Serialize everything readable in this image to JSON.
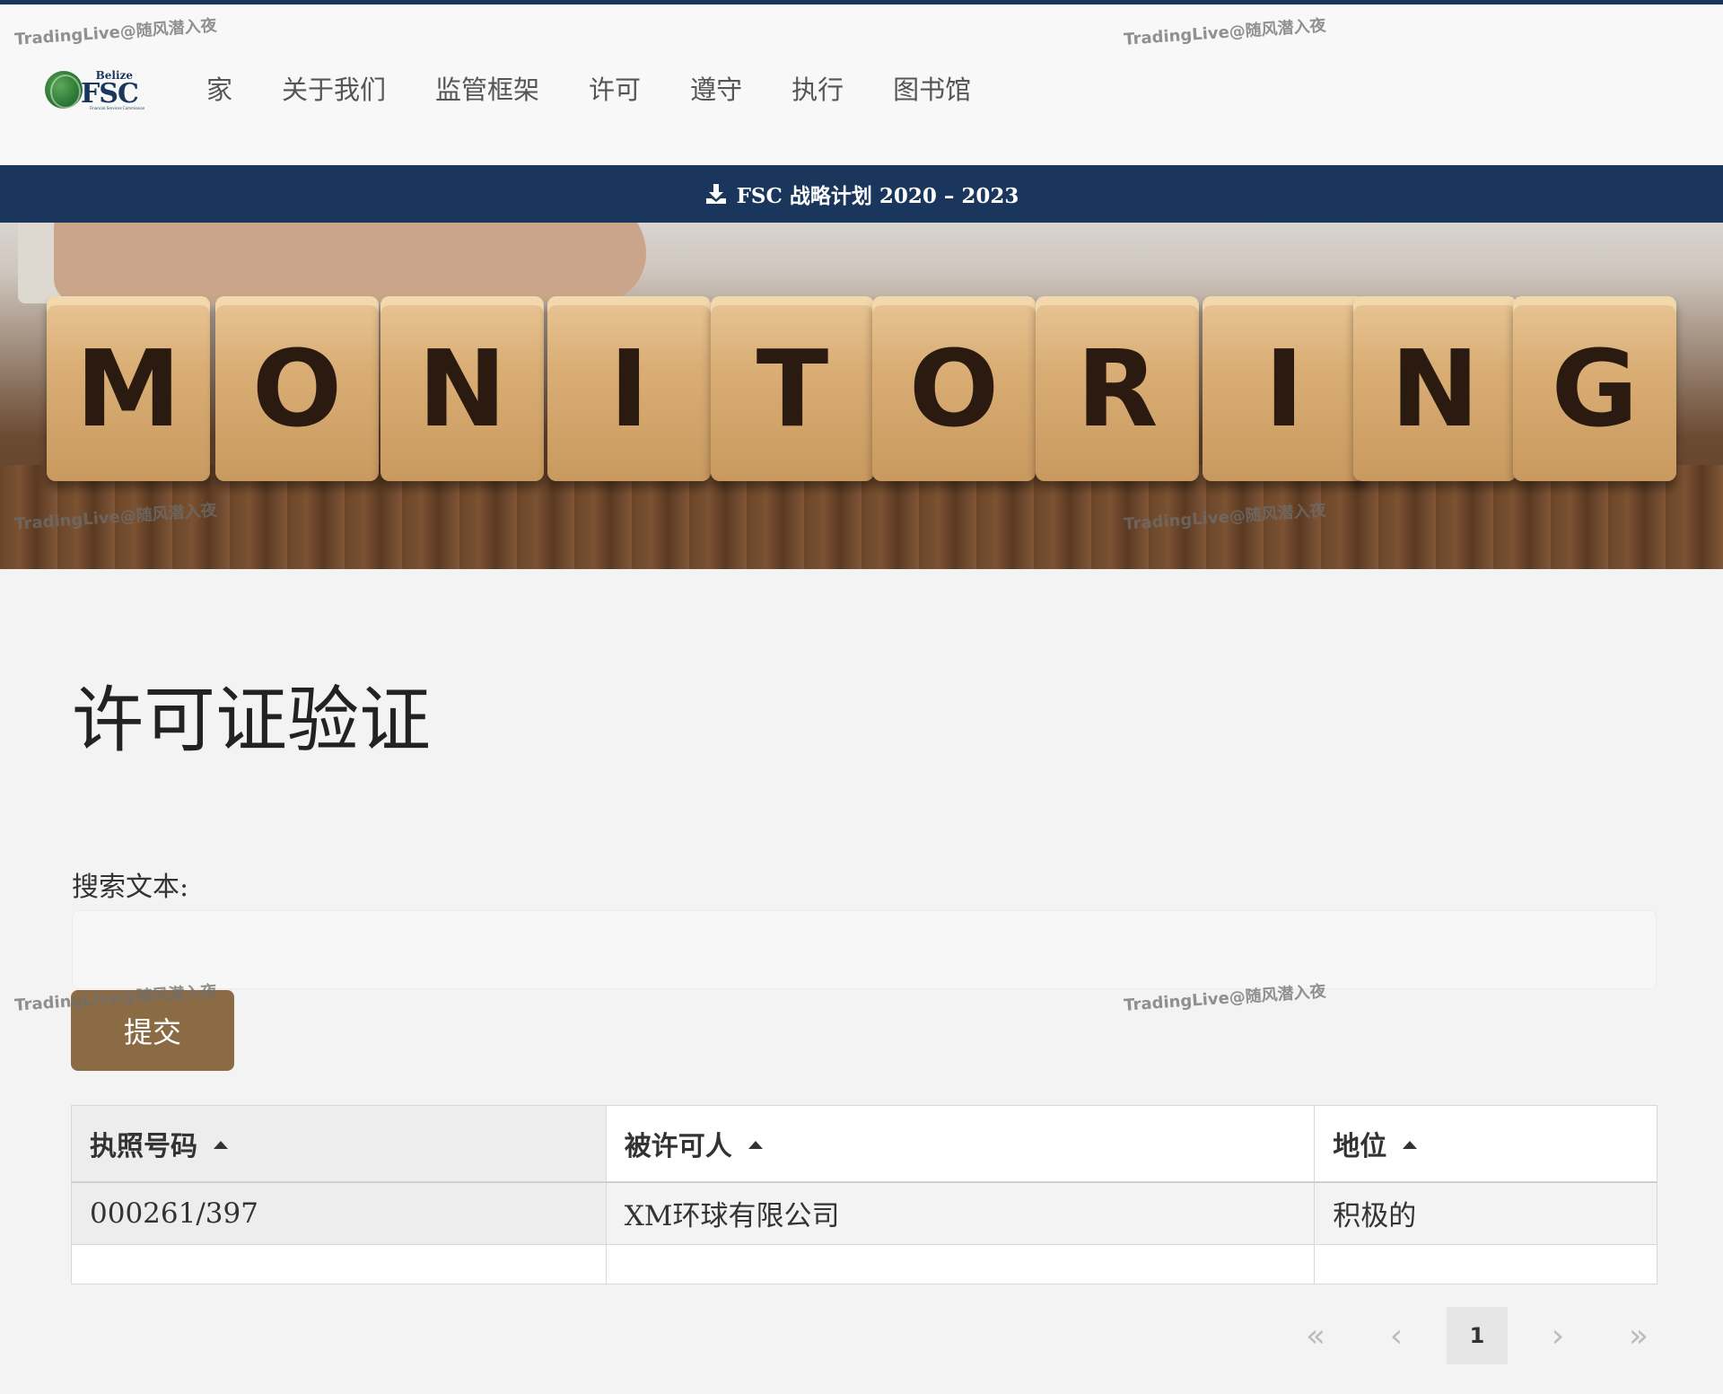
{
  "logo": {
    "country": "Belize",
    "name": "FSC",
    "subtitle": "Financial Services Commission"
  },
  "nav": {
    "items": [
      "家",
      "关于我们",
      "监管框架",
      "许可",
      "遵守",
      "执行",
      "图书馆"
    ]
  },
  "announcement": {
    "label": "FSC 战略计划 2020 – 2023",
    "icon": "download-icon"
  },
  "hero": {
    "letters": [
      "M",
      "O",
      "N",
      "I",
      "T",
      "O",
      "R",
      "I",
      "N",
      "G"
    ]
  },
  "page": {
    "title": "许可证验证"
  },
  "search": {
    "label": "搜索文本:",
    "value": "",
    "placeholder": "",
    "submit_label": "提交"
  },
  "table": {
    "columns": [
      "执照号码",
      "被许可人",
      "地位"
    ],
    "rows": [
      [
        "000261/397",
        "XM环球有限公司",
        "积极的"
      ]
    ]
  },
  "pagination": {
    "first": "«",
    "prev": "‹",
    "current": "1",
    "next": "›",
    "last": "»"
  },
  "watermark": {
    "text": "TradingLive@随风潜入夜"
  },
  "colors": {
    "navy": "#1b365d",
    "accent_button": "#8b6b43"
  }
}
